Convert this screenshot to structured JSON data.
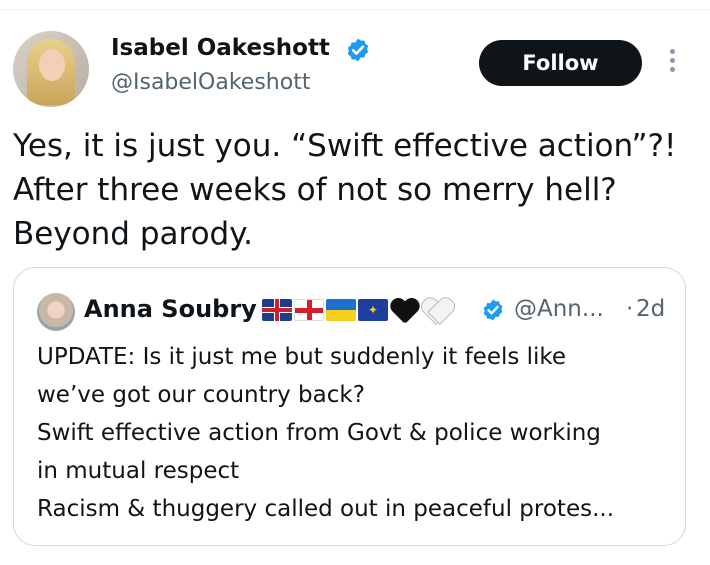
{
  "author": {
    "name": "Isabel Oakeshott",
    "handle": "@IsabelOakeshott",
    "verified": true,
    "avatar_icon": "profile-photo"
  },
  "actions": {
    "follow_label": "Follow",
    "more_icon": "vertical-ellipsis-icon"
  },
  "tweet": {
    "lines": [
      "Yes, it is just you. “Swift effective action”?!",
      "After three weeks of not so merry hell?",
      "Beyond parody."
    ]
  },
  "quoted": {
    "name": "Anna Soubry",
    "name_emojis": [
      "uk-flag",
      "england-flag",
      "ukraine-flag",
      "eu-flag",
      "black-heart",
      "white-heart"
    ],
    "verified": true,
    "handle": "@Ann...",
    "separator": "·",
    "time": "2d",
    "lines": [
      "UPDATE: Is it just me but suddenly it feels like",
      "we’ve got our country back?",
      "Swift effective action from Govt & police working",
      "in mutual respect",
      "Racism & thuggery called out in peaceful protes..."
    ]
  },
  "colors": {
    "verified_blue": "#1d9bf0",
    "follow_bg": "#0f1419",
    "secondary_text": "#536471",
    "border": "#cfd9de"
  }
}
